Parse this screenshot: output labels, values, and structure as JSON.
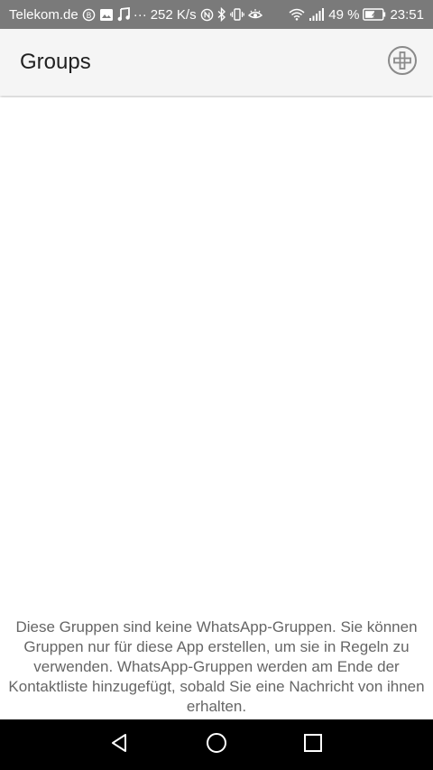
{
  "status_bar": {
    "carrier": "Telekom.de",
    "network_speed": "252 K/s",
    "battery_percent": "49 %",
    "time": "23:51",
    "dots": "···",
    "icons": [
      "data-saver-icon",
      "image-icon",
      "music-note-icon",
      "nfc-icon",
      "bluetooth-icon",
      "vibrate-icon",
      "eye-comfort-icon",
      "wifi-icon",
      "signal-icon",
      "battery-icon"
    ]
  },
  "app_bar": {
    "title": "Groups",
    "add_icon": "add-circle-icon"
  },
  "content": {
    "info_text": "Diese Gruppen sind keine WhatsApp-Gruppen. Sie können Gruppen nur für diese App erstellen, um sie in Regeln zu verwenden. WhatsApp-Gruppen werden am Ende der Kontaktliste hinzugefügt, sobald Sie eine Nachricht von ihnen erhalten."
  },
  "nav_bar": {
    "icons": [
      "back-icon",
      "home-icon",
      "recents-icon"
    ]
  },
  "colors": {
    "status_bar": "#7a7a7a",
    "app_bar": "#f5f5f5",
    "nav_bar": "#000000",
    "info_text": "#666666"
  }
}
